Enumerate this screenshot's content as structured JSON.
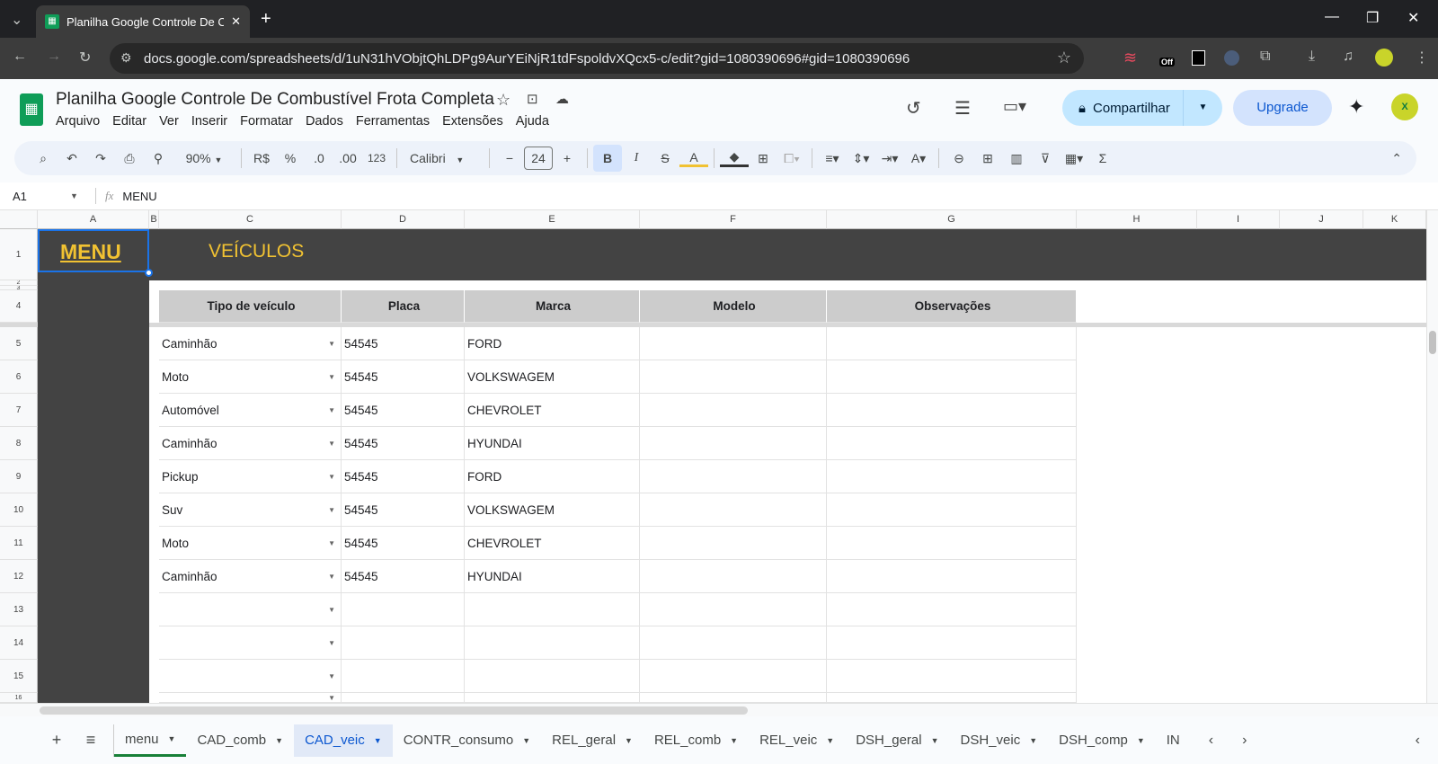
{
  "browser": {
    "tab_title": "Planilha Google Controle De Co",
    "url": "docs.google.com/spreadsheets/d/1uN31hVObjtQhLDPg9AurYEiNjR1tdFspoldvXQcx5-c/edit?gid=1080390696#gid=1080390696",
    "ext_badge": "Off"
  },
  "doc": {
    "title": "Planilha Google Controle De Combustível Frota Completa",
    "menu": [
      "Arquivo",
      "Editar",
      "Ver",
      "Inserir",
      "Formatar",
      "Dados",
      "Ferramentas",
      "Extensões",
      "Ajuda"
    ],
    "share_label": "Compartilhar",
    "upgrade_label": "Upgrade"
  },
  "toolbar": {
    "zoom": "90%",
    "currency": "R$",
    "percent": "%",
    "dec_less": ".0",
    "dec_more": ".00",
    "number_format": "123",
    "font": "Calibri",
    "font_size": "24"
  },
  "formula_bar": {
    "cell_ref": "A1",
    "fx": "fx",
    "value": "MENU"
  },
  "columns": [
    "A",
    "B",
    "C",
    "D",
    "E",
    "F",
    "G",
    "H",
    "I",
    "J",
    "K"
  ],
  "rows": [
    "1",
    "2",
    "3",
    "4",
    "5",
    "6",
    "7",
    "8",
    "9",
    "10",
    "11",
    "12",
    "13",
    "14",
    "15",
    "16"
  ],
  "sheet": {
    "menu_link": "MENU",
    "heading": "VEÍCULOS",
    "headers": [
      "Tipo de veículo",
      "Placa",
      "Marca",
      "Modelo",
      "Observações"
    ],
    "data": [
      [
        "Caminhão",
        "54545",
        "FORD",
        "",
        ""
      ],
      [
        "Moto",
        "54545",
        "VOLKSWAGEM",
        "",
        ""
      ],
      [
        "Automóvel",
        "54545",
        "CHEVROLET",
        "",
        ""
      ],
      [
        "Caminhão",
        "54545",
        "HYUNDAI",
        "",
        ""
      ],
      [
        "Pickup",
        "54545",
        "FORD",
        "",
        ""
      ],
      [
        "Suv",
        "54545",
        "VOLKSWAGEM",
        "",
        ""
      ],
      [
        "Moto",
        "54545",
        "CHEVROLET",
        "",
        ""
      ],
      [
        "Caminhão",
        "54545",
        "HYUNDAI",
        "",
        ""
      ],
      [
        "",
        "",
        "",
        "",
        ""
      ],
      [
        "",
        "",
        "",
        "",
        ""
      ],
      [
        "",
        "",
        "",
        "",
        ""
      ],
      [
        "",
        "",
        "",
        "",
        ""
      ]
    ]
  },
  "sheet_tabs": [
    "menu",
    "CAD_comb",
    "CAD_veic",
    "CONTR_consumo",
    "REL_geral",
    "REL_comb",
    "REL_veic",
    "DSH_geral",
    "DSH_veic",
    "DSH_comp",
    "IN"
  ],
  "active_tab": "CAD_veic",
  "colors": {
    "dark_band": "#434343",
    "accent_yellow": "#f1c232",
    "header_grey": "#cccccc"
  }
}
